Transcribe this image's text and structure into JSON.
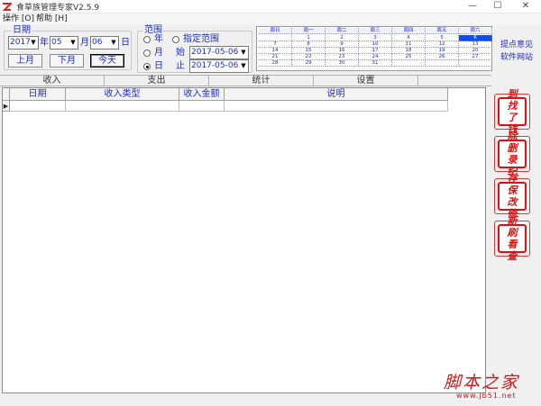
{
  "window": {
    "title": "食草族管理专家V2.5.9",
    "minimize_glyph": "—",
    "maximize_glyph": "☐",
    "close_glyph": "✕",
    "icon": "app-logo-icon"
  },
  "menu": {
    "operate": "操作 [O]",
    "help": "帮助 [H]"
  },
  "date_group": {
    "legend": "日期",
    "year_value": "2017",
    "year_label": "年",
    "month_value": "05",
    "month_label": "月",
    "day_value": "06",
    "day_label": "日",
    "prev_month": "上月",
    "next_month": "下月",
    "today": "今天"
  },
  "range_group": {
    "legend": "范围",
    "year": "年",
    "month": "月",
    "day": "日",
    "custom": "指定范围",
    "start_label": "始",
    "end_label": "止",
    "start_value": "2017-05-06",
    "end_value": "2017-05-06",
    "selected": "day"
  },
  "calendar": {
    "headers": [
      "周日",
      "周一",
      "周二",
      "周三",
      "周四",
      "周五",
      "周六"
    ],
    "weeks": [
      [
        "",
        "1",
        "2",
        "3",
        "4",
        "5",
        "6"
      ],
      [
        "7",
        "8",
        "9",
        "10",
        "11",
        "12",
        "13"
      ],
      [
        "14",
        "15",
        "16",
        "17",
        "18",
        "19",
        "20"
      ],
      [
        "21",
        "22",
        "23",
        "24",
        "25",
        "26",
        "27"
      ],
      [
        "28",
        "29",
        "30",
        "31",
        "",
        "",
        ""
      ]
    ],
    "selected_day": "6"
  },
  "side_links": {
    "feedback": "提点意见",
    "website": "软件网站"
  },
  "tabs": [
    "收入",
    "支出",
    "统计",
    "设置"
  ],
  "grid": {
    "columns": [
      "日期",
      "收入类型",
      "收入金额",
      "说明"
    ],
    "row_indicator": "▶"
  },
  "seals": [
    {
      "chars": [
        "找",
        "到",
        "钱",
        "了"
      ]
    },
    {
      "chars": [
        "删",
        "除",
        "纪",
        "录"
      ]
    },
    {
      "chars": [
        "保",
        "存",
        "修",
        "改"
      ]
    },
    {
      "chars": [
        "刷",
        "新",
        "查",
        "看"
      ]
    }
  ],
  "watermark": {
    "main": "脚本之家",
    "sub": "www.jb51.net"
  },
  "colors": {
    "accent": "#1a2ccf",
    "seal_red": "#d11111",
    "calendar_selected": "#0a4ef0"
  }
}
